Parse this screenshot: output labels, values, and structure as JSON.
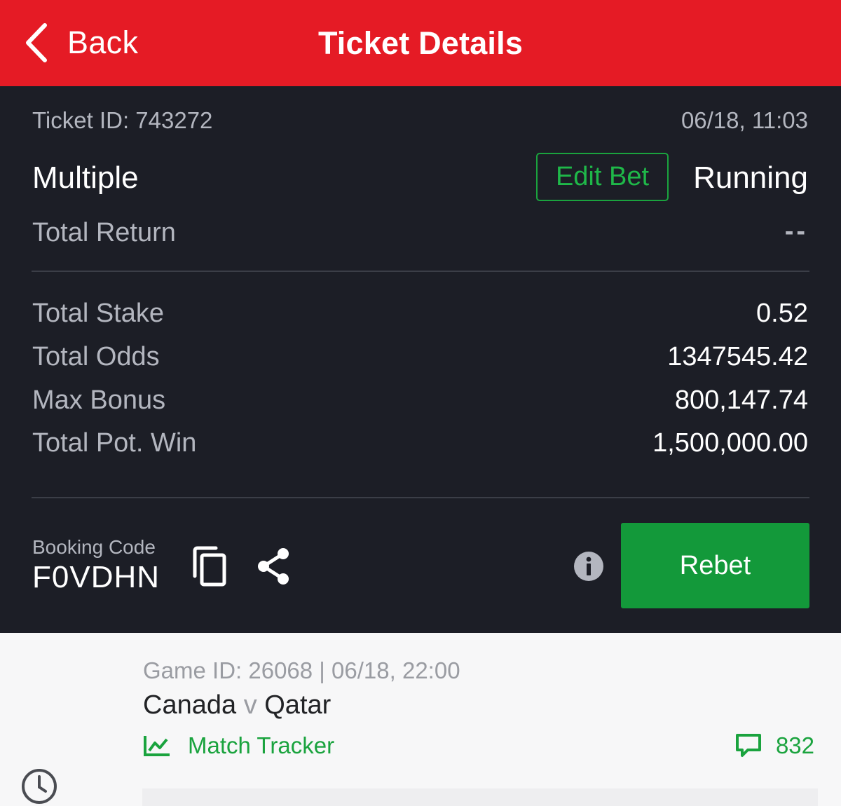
{
  "header": {
    "back_label": "Back",
    "title": "Ticket Details"
  },
  "ticket": {
    "id_text": "Ticket ID: 743272",
    "datetime": "06/18, 11:03",
    "type": "Multiple",
    "edit_bet_label": "Edit Bet",
    "status": "Running",
    "total_return_label": "Total Return",
    "total_return_value": "--"
  },
  "summary": [
    {
      "label": "Total Stake",
      "value": "0.52"
    },
    {
      "label": "Total Odds",
      "value": "1347545.42"
    },
    {
      "label": "Max Bonus",
      "value": "800,147.74"
    },
    {
      "label": "Total Pot. Win",
      "value": "1,500,000.00"
    }
  ],
  "booking": {
    "label": "Booking Code",
    "code": "F0VDHN",
    "rebet_label": "Rebet"
  },
  "game": {
    "meta": "Game ID: 26068 | 06/18, 22:00",
    "home": "Canada",
    "vs": "v",
    "away": "Qatar",
    "tracker_label": "Match Tracker",
    "comment_count": "832"
  },
  "icons": {
    "back": "chevron-left-icon",
    "copy": "copy-icon",
    "share": "share-icon",
    "info": "info-icon",
    "tracker": "line-chart-icon",
    "comments": "comment-icon",
    "clock": "clock-icon"
  },
  "colors": {
    "header_bg": "#e51b25",
    "panel_bg": "#1c1e26",
    "accent_green": "#13993a",
    "game_bg": "#f7f7f8"
  }
}
